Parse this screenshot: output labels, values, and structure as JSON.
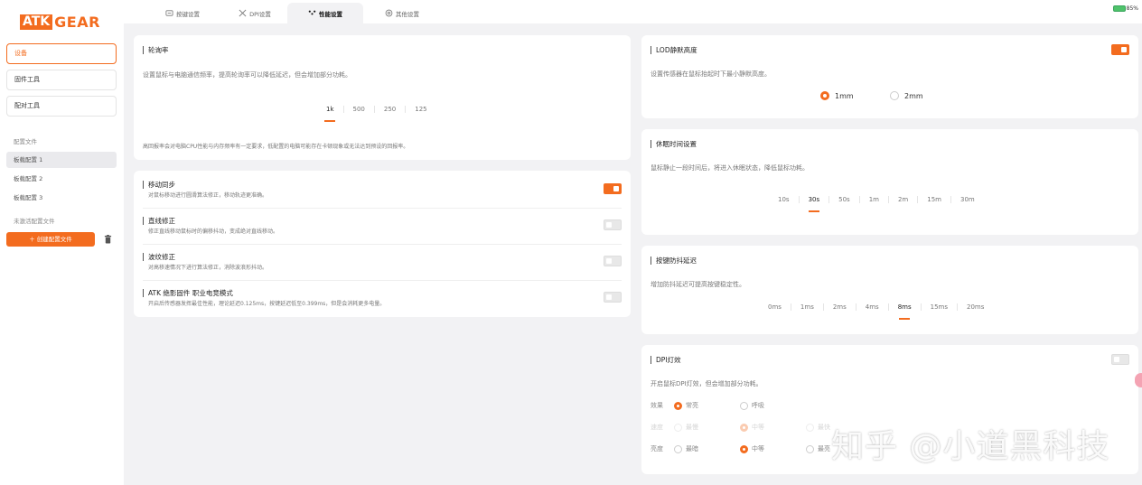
{
  "brand": {
    "logo_box": "ATK",
    "logo_text": "GEAR",
    "accent": "#f36c1f"
  },
  "sidebar": {
    "buttons": [
      {
        "label": "设备"
      },
      {
        "label": "固件工具"
      },
      {
        "label": "配对工具"
      }
    ],
    "profiles_label": "配置文件",
    "profiles": [
      {
        "label": "板载配置 1"
      },
      {
        "label": "板载配置 2"
      },
      {
        "label": "板载配置 3"
      }
    ],
    "inactive_label": "未激活配置文件",
    "new_button": "＋ 创建配置文件"
  },
  "tabs": [
    {
      "label": "按键设置",
      "icon": "keys-icon"
    },
    {
      "label": "DPI设置",
      "icon": "dpi-icon"
    },
    {
      "label": "性能设置",
      "icon": "performance-icon"
    },
    {
      "label": "其他设置",
      "icon": "settings-icon"
    }
  ],
  "battery": {
    "percent_text": "85%"
  },
  "polling": {
    "title": "轮询率",
    "desc": "设置鼠标与电脑通信频率，提高轮询率可以降低延迟，但会增加部分功耗。",
    "options": [
      "1k",
      "500",
      "250",
      "125"
    ],
    "selected": "1k",
    "note": "高回报率会对电脑CPU性能与内存频率有一定要求，低配置的电脑可能存在卡顿现象或无法达到预设的回报率。"
  },
  "toggles": [
    {
      "title": "移动同步",
      "desc": "对鼠标移动进行圆滑算法修正，移动轨迹更准确。",
      "on": true
    },
    {
      "title": "直线修正",
      "desc": "修正直线移动鼠标时的偏移抖动，变成绝对直线移动。",
      "on": false
    },
    {
      "title": "波纹修正",
      "desc": "对高移速情况下进行算法修正，消除波浪形抖动。",
      "on": false
    },
    {
      "title": "ATK 绝影固件 职业电竞模式",
      "desc": "开启后传感器发挥最佳性能，理论延迟0.125ms，按键延迟低至0.399ms，但是会消耗更多电量。",
      "on": false
    }
  ],
  "lod": {
    "title": "LOD静默高度",
    "desc": "设置传感器在鼠标抬起时下最小静默高度。",
    "on": true,
    "options": [
      "1mm",
      "2mm"
    ],
    "selected": "1mm"
  },
  "sleep": {
    "title": "休眠时间设置",
    "desc": "鼠标静止一段时间后，将进入休眠状态，降低鼠标功耗。",
    "options": [
      "10s",
      "30s",
      "50s",
      "1m",
      "2m",
      "15m",
      "30m"
    ],
    "selected": "30s"
  },
  "debounce": {
    "title": "按键防抖延迟",
    "desc": "增加防抖延迟可提高按键稳定性。",
    "options": [
      "0ms",
      "1ms",
      "2ms",
      "4ms",
      "8ms",
      "15ms",
      "20ms"
    ],
    "selected": "8ms"
  },
  "dpi_light": {
    "title": "DPI灯效",
    "desc": "开启鼠标DPI灯效，但会增加部分功耗。",
    "on": false,
    "rows": [
      {
        "label": "效果",
        "options": [
          "常亮",
          "呼吸"
        ],
        "selected": 0
      },
      {
        "label": "速度",
        "options": [
          "最慢",
          "中等",
          "最快"
        ],
        "selected": 1
      },
      {
        "label": "亮度",
        "options": [
          "最暗",
          "中等",
          "最亮"
        ],
        "selected": 1
      }
    ]
  },
  "watermark": "知乎 @小道黑科技"
}
